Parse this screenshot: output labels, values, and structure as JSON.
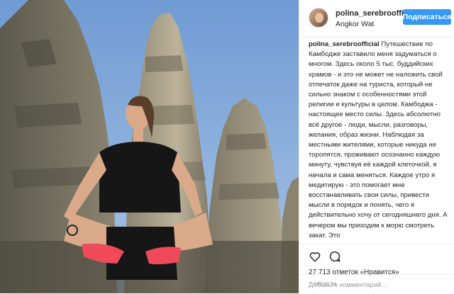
{
  "post": {
    "username": "polina_serebrooffi",
    "location": "Angkor Wat",
    "follow_label": "Подписаться",
    "caption_user": "polina_serebroofficial",
    "caption_text": "Путешествие по Камбодже заставило меня задуматься о многом. Здесь около 5 тыс. буддийских храмов - и это не может не наложить свой отпечаток даже на туриста, который не сильно знаком с особенностями этой религии и культуры в целом. Камбоджа - настоящее место силы. Здесь абсолютно всё другое - люди, мысли, разговоры, желания, образ жизни. Наблюдая за местными жителями, которые никуда не торопятся, проживают осознанно каждую минуту, чувствуя её каждой клеточкой, я начала и сама меняться. Каждое утро я медитирую - это помогает мне восстанавливать свои силы, привести мысли в порядок и понять, чего я действительно хочу от сегодняшнего дня. А вечером мы приходим к морю смотреть закат. Это",
    "likes": "27 713 отметок «Нравится»",
    "date": "7 АВГУСТА",
    "comment_placeholder": "Добавьте комментарий..."
  },
  "icons": {
    "like": "heart-icon",
    "comment": "comment-icon"
  },
  "colors": {
    "accent": "#3897f0",
    "sky": "#7fa7d6",
    "stone": "#6f6a5c",
    "shirt": "#161616",
    "shoes": "#f04a5a"
  }
}
